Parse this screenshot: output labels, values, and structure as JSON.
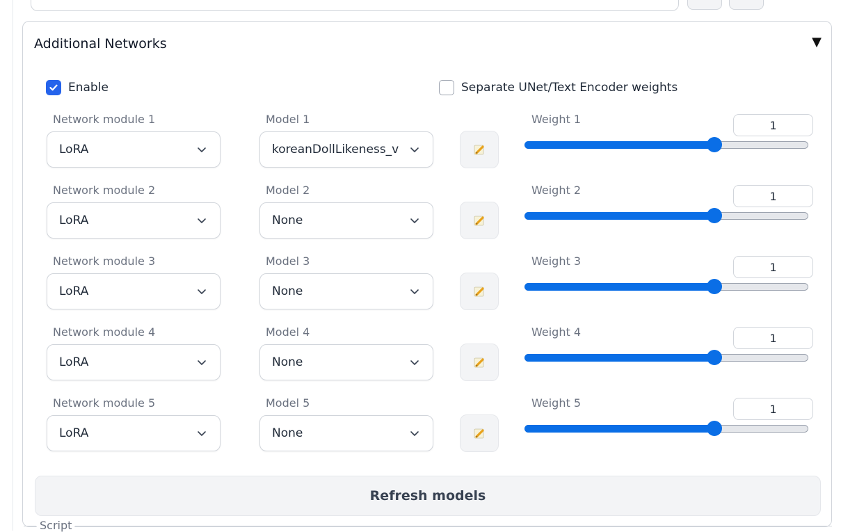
{
  "panel": {
    "title": "Additional Networks",
    "collapse_icon": "▼"
  },
  "enable": {
    "label": "Enable",
    "checked": true
  },
  "separate_weights": {
    "label": "Separate UNet/Text Encoder weights",
    "checked": false
  },
  "rows": [
    {
      "module_label": "Network module 1",
      "module_value": "LoRA",
      "model_label": "Model 1",
      "model_value": "koreanDollLikeness_v",
      "weight_label": "Weight 1",
      "weight_value": "1",
      "slider_fraction": 0.67
    },
    {
      "module_label": "Network module 2",
      "module_value": "LoRA",
      "model_label": "Model 2",
      "model_value": "None",
      "weight_label": "Weight 2",
      "weight_value": "1",
      "slider_fraction": 0.67
    },
    {
      "module_label": "Network module 3",
      "module_value": "LoRA",
      "model_label": "Model 3",
      "model_value": "None",
      "weight_label": "Weight 3",
      "weight_value": "1",
      "slider_fraction": 0.67
    },
    {
      "module_label": "Network module 4",
      "module_value": "LoRA",
      "model_label": "Model 4",
      "model_value": "None",
      "weight_label": "Weight 4",
      "weight_value": "1",
      "slider_fraction": 0.67
    },
    {
      "module_label": "Network module 5",
      "module_value": "LoRA",
      "model_label": "Model 5",
      "model_value": "None",
      "weight_label": "Weight 5",
      "weight_value": "1",
      "slider_fraction": 0.67
    }
  ],
  "refresh_label": "Refresh models",
  "script_label": "Script",
  "colors": {
    "accent": "#0a6ee6",
    "checkbox": "#2563eb"
  }
}
